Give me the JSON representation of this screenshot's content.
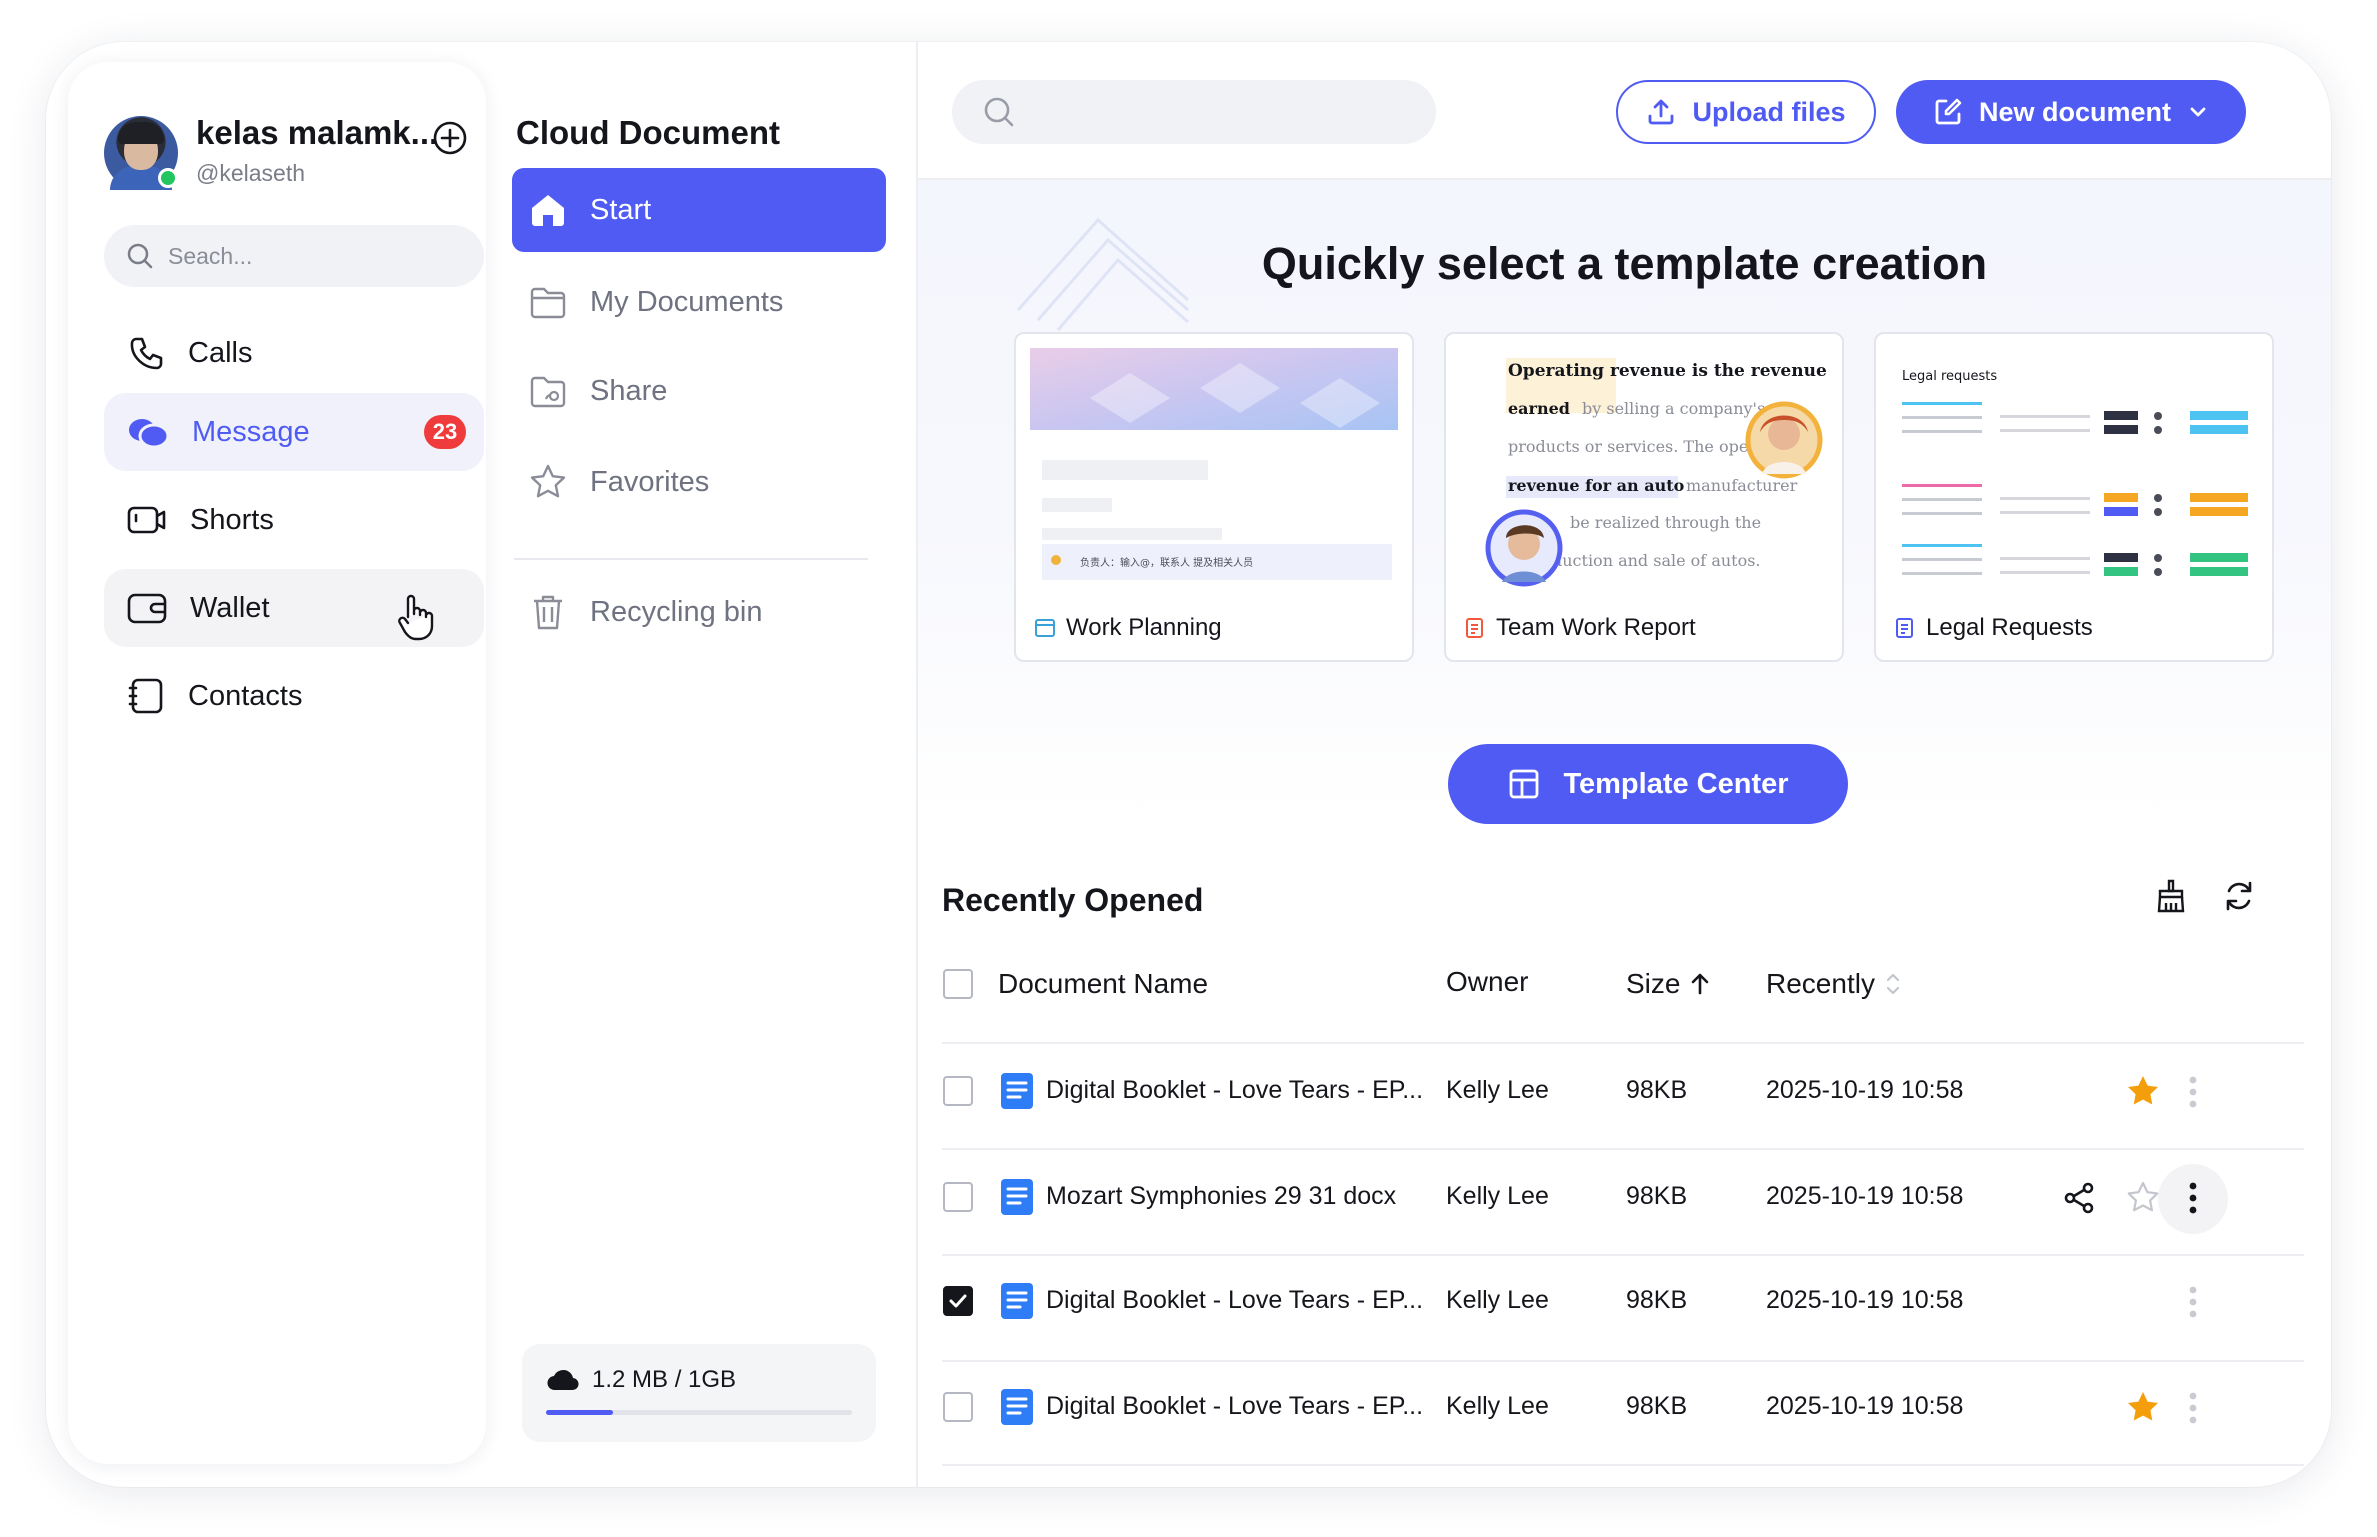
{
  "user": {
    "name": "kelas malamk...",
    "handle": "@kelaseth"
  },
  "left_search": {
    "placeholder": "Seach..."
  },
  "nav": [
    {
      "label": "Calls"
    },
    {
      "label": "Message",
      "badge": "23"
    },
    {
      "label": "Shorts"
    },
    {
      "label": "Wallet"
    },
    {
      "label": "Contacts"
    }
  ],
  "cloud": {
    "title": "Cloud Document",
    "items": [
      {
        "label": "Start"
      },
      {
        "label": "My Documents"
      },
      {
        "label": "Share"
      },
      {
        "label": "Favorites"
      },
      {
        "label": "Recycling bin"
      }
    ],
    "storage": {
      "label": "1.2 MB / 1GB",
      "used_fraction": 0.22
    }
  },
  "toolbar": {
    "upload_label": "Upload files",
    "new_label": "New document"
  },
  "hero": {
    "title": "Quickly select a template creation",
    "templates": [
      {
        "label": "Work Planning",
        "preview_text": [
          "负责人：输入@，联系人 提及相关人员"
        ]
      },
      {
        "label": "Team Work Report",
        "preview_text": [
          "Operating revenue is the revenue",
          "earned",
          "by selling a company's",
          "products or services. The opera",
          "revenue for an auto",
          "manufacturer",
          "be realized through the",
          "duction and sale of autos."
        ]
      },
      {
        "label": "Legal Requests",
        "preview_text": [
          "Legal requests"
        ]
      }
    ],
    "template_center_label": "Template Center"
  },
  "recent": {
    "title": "Recently Opened",
    "columns": {
      "name": "Document Name",
      "owner": "Owner",
      "size": "Size",
      "recently": "Recently"
    },
    "rows": [
      {
        "name": "Digital Booklet - Love Tears - EP...",
        "owner": "Kelly Lee",
        "size": "98KB",
        "date": "2025-10-19 10:58",
        "starred": true,
        "checked": false
      },
      {
        "name": "Mozart Symphonies 29 31 docx",
        "owner": "Kelly Lee",
        "size": "98KB",
        "date": "2025-10-19 10:58",
        "starred": false,
        "checked": false
      },
      {
        "name": "Digital Booklet - Love Tears - EP...",
        "owner": "Kelly Lee",
        "size": "98KB",
        "date": "2025-10-19 10:58",
        "starred": false,
        "checked": true
      },
      {
        "name": "Digital Booklet - Love Tears - EP...",
        "owner": "Kelly Lee",
        "size": "98KB",
        "date": "2025-10-19 10:58",
        "starred": true,
        "checked": false
      }
    ]
  },
  "colors": {
    "accent": "#4f5bf3",
    "badge": "#ef3b3b",
    "star": "#f59e0b",
    "online": "#22c55e"
  }
}
